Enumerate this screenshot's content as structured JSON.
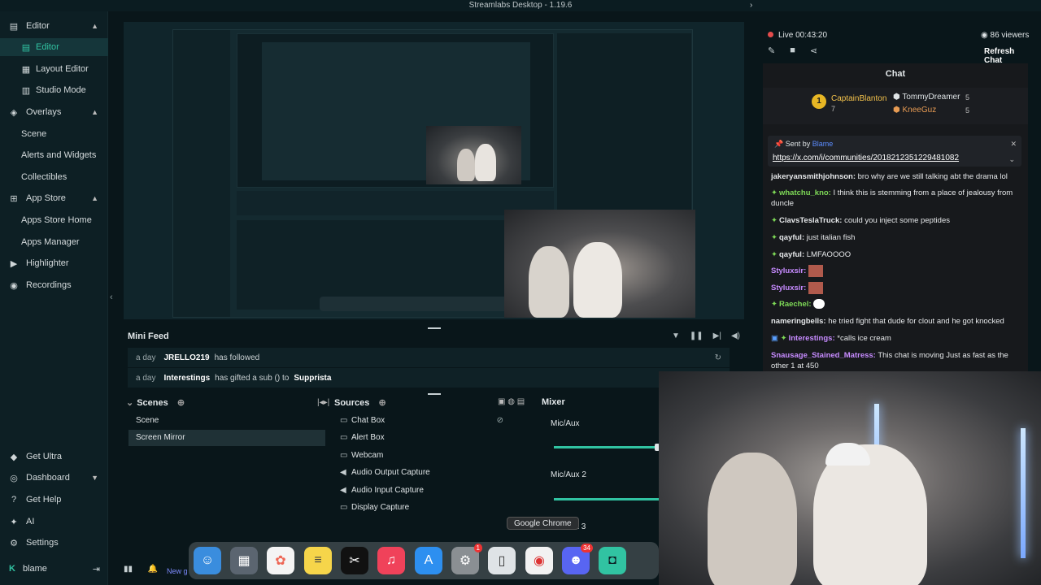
{
  "window": {
    "title": "Streamlabs Desktop - 1.19.6"
  },
  "sidebar": {
    "editor": "Editor",
    "items": [
      {
        "label": "Editor"
      },
      {
        "label": "Layout Editor"
      },
      {
        "label": "Studio Mode"
      }
    ],
    "overlays": "Overlays",
    "overlay_items": [
      "Scene",
      "Alerts and Widgets",
      "Collectibles"
    ],
    "app_store": "App Store",
    "app_items": [
      "Apps Store Home",
      "Apps Manager"
    ],
    "highlighter": "Highlighter",
    "recordings": "Recordings",
    "get_ultra": "Get Ultra",
    "dashboard": "Dashboard",
    "get_help": "Get Help",
    "ai": "AI",
    "settings": "Settings",
    "user": "blame"
  },
  "mini_feed": {
    "title": "Mini Feed",
    "rows": [
      {
        "when": "a day",
        "name": "JRELLO219",
        "action": "has followed",
        "target": ""
      },
      {
        "when": "a day",
        "name": "Interestings",
        "action": "has gifted a sub () to",
        "target": "Supprista"
      }
    ]
  },
  "scenes": {
    "title": "Scenes",
    "items": [
      "Scene",
      "Screen Mirror"
    ]
  },
  "sources": {
    "title": "Sources",
    "items": [
      "Chat Box",
      "Alert Box",
      "Webcam",
      "Audio Output Capture",
      "Audio Input Capture",
      "Display Capture"
    ]
  },
  "mixer": {
    "title": "Mixer",
    "channels": [
      {
        "label": "Mic/Aux",
        "level": 0.99
      },
      {
        "label": "Mic/Aux 2",
        "level": 1.0
      }
    ],
    "partial": "x 3"
  },
  "stream": {
    "live": "Live 00:43:20",
    "viewers": "86 viewers",
    "refresh": "Refresh Chat"
  },
  "chat": {
    "title": "Chat",
    "leaderboard": {
      "first": "CaptainBlanton",
      "first_count": "7",
      "second": "TommyDreamer",
      "second_count": "5",
      "third": "KneeGuz",
      "third_count": "5"
    },
    "pinned": {
      "sent_by": "Sent by",
      "sender": "Blame",
      "url": "https://x.com/i/communities/2018212351229481082"
    },
    "messages": [
      {
        "user": "jakeryansmithjohnson:",
        "text": "bro why are we still talking abt the drama lol",
        "color": "#e6e8ea"
      },
      {
        "user": "whatchu_kno:",
        "text": "I think this is stemming from a place of jealousy from duncle",
        "color": "#7ed957"
      },
      {
        "user": "ClavsTeslaTruck:",
        "text": "could you inject some peptides",
        "color": "#e6e8ea"
      },
      {
        "user": "qayful:",
        "text": "just italian fish",
        "color": "#e6e8ea"
      },
      {
        "user": "qayful:",
        "text": "LMFAOOOO",
        "color": "#e6e8ea"
      },
      {
        "user": "Styluxsir:",
        "text": "",
        "color": "#c78bff"
      },
      {
        "user": "Styluxsir:",
        "text": "",
        "color": "#c78bff"
      },
      {
        "user": "Raechel:",
        "text": "",
        "color": "#7ed957"
      },
      {
        "user": "nameringbells:",
        "text": "he tried fight that dude for clout and he got knocked",
        "color": "#e6e8ea"
      },
      {
        "user": "Interestings:",
        "text": "*calls ice cream",
        "color": "#c78bff"
      },
      {
        "user": "Snausage_Stained_Matress:",
        "text": "This chat is moving Just as fast as the other 1 at 450",
        "color": "#c78bff"
      }
    ]
  },
  "dock": {
    "tooltip": "Google Chrome",
    "icons": [
      {
        "name": "finder",
        "badge": ""
      },
      {
        "name": "launchpad",
        "badge": ""
      },
      {
        "name": "photos",
        "badge": ""
      },
      {
        "name": "notes",
        "badge": ""
      },
      {
        "name": "capcut",
        "badge": ""
      },
      {
        "name": "music",
        "badge": ""
      },
      {
        "name": "app-store",
        "badge": ""
      },
      {
        "name": "system-settings",
        "badge": "1"
      },
      {
        "name": "iphone-mirroring",
        "badge": ""
      },
      {
        "name": "google-chrome",
        "badge": ""
      },
      {
        "name": "discord",
        "badge": "34"
      },
      {
        "name": "streamlabs",
        "badge": ""
      }
    ]
  },
  "footer": {
    "new_goal": "New g"
  },
  "colors": {
    "accent": "#31c3a2",
    "background": "#09161a",
    "live": "#e44c4c"
  }
}
